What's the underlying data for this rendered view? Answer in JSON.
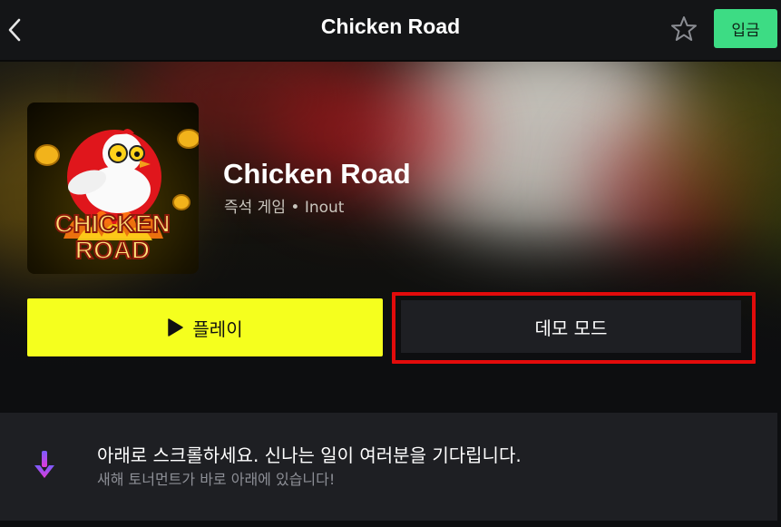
{
  "header": {
    "title": "Chicken Road",
    "deposit_label": "입금",
    "back_icon": "chevron-left-icon",
    "favorite_icon": "star-outline-icon"
  },
  "game": {
    "name": "Chicken Road",
    "category": "즉석 게임",
    "separator": "•",
    "provider": "Inout",
    "thumbnail_text_line1": "CHICKEN",
    "thumbnail_text_line2": "ROAD"
  },
  "actions": {
    "play_label": "플레이",
    "play_icon": "play-icon",
    "demo_label": "데모 모드",
    "highlight_color": "#e20b0b"
  },
  "notice": {
    "title": "아래로 스크롤하세요. 신나는 일이 여러분을 기다립니다.",
    "subtitle": "새해 토너먼트가 바로 아래에 있습니다!",
    "icon": "arrow-down-icon"
  },
  "colors": {
    "accent_green": "#3ddc84",
    "play_yellow": "#f5ff1e",
    "panel_dark": "#1e1f23"
  }
}
